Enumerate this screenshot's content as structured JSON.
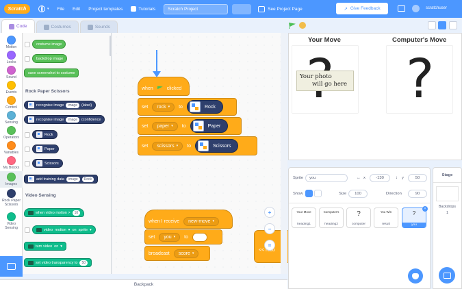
{
  "menu": {
    "logo": "Scratch",
    "file": "File",
    "edit": "Edit",
    "project_templates": "Project templates",
    "tutorials": "Tutorials",
    "project_title": "Scratch Project",
    "see_project_page": "See Project Page",
    "give_feedback": "Give Feedback",
    "account": "scratchuser"
  },
  "tabs": {
    "code": "Code",
    "costumes": "Costumes",
    "sounds": "Sounds"
  },
  "categories": [
    {
      "label": "Motion",
      "color": "#4c97ff"
    },
    {
      "label": "Looks",
      "color": "#9966ff"
    },
    {
      "label": "Sound",
      "color": "#cf63cf"
    },
    {
      "label": "Events",
      "color": "#ffbf00"
    },
    {
      "label": "Control",
      "color": "#ffab19"
    },
    {
      "label": "Sensing",
      "color": "#5cb1d6"
    },
    {
      "label": "Operators",
      "color": "#59c059"
    },
    {
      "label": "Variables",
      "color": "#ff8c1a"
    },
    {
      "label": "My Blocks",
      "color": "#ff6680"
    },
    {
      "label": "Images",
      "color": "#59c059"
    },
    {
      "label": "Rock Paper Scissors",
      "color": "#2e3f6c"
    },
    {
      "label": "Video Sensing",
      "color": "#0fbd8c"
    }
  ],
  "palette": {
    "costume_image": "costume image",
    "backdrop_image": "backdrop image",
    "save_screenshot": "save screenshot to costume",
    "rps_section": "Rock Paper Scissors",
    "recognise_label": "recognise image",
    "image_slot": "image",
    "label_suffix": "(label)",
    "confidence_suffix": "(confidence",
    "rock": "Rock",
    "paper": "Paper",
    "scissors": "Scissors",
    "add_training": "add training data",
    "add_training_value": "Rock",
    "video_section": "Video Sensing",
    "when_motion": "when video motion >",
    "when_motion_value": "10",
    "video_motion": "video",
    "video_motion_dd": "motion",
    "on": "on",
    "on_sprite": "sprite",
    "turn_video": "turn video",
    "turn_video_value": "on",
    "set_transparency": "set video transparency to",
    "set_transparency_value": "50"
  },
  "script1": {
    "when": "when",
    "clicked": "clicked",
    "set": "set",
    "to": "to",
    "rows": [
      {
        "var": "rock",
        "value": "Rock"
      },
      {
        "var": "paper",
        "value": "Paper"
      },
      {
        "var": "scissors",
        "value": "Scissors"
      }
    ]
  },
  "script2": {
    "when_receive": "when I receive",
    "message": "new-move",
    "set": "set",
    "var": "you",
    "to": "to",
    "broadcast": "broadcast",
    "broadcast_msg": "score"
  },
  "background_hat": "<< reco",
  "zoom": {
    "in": "+",
    "out": "−"
  },
  "backpack": "Backpack",
  "stage": {
    "your_move": "Your Move",
    "computer_move": "Computer's Move",
    "qmark": "?",
    "photo_placeholder_line1": "Your photo",
    "photo_placeholder_line2": "will go here"
  },
  "sprite_info": {
    "sprite_label": "Sprite",
    "sprite_name": "you",
    "x_label": "x",
    "x_value": "-130",
    "y_label": "y",
    "y_value": "50",
    "show_label": "Show",
    "size_label": "Size",
    "size_value": "100",
    "direction_label": "Direction",
    "direction_value": "90"
  },
  "sprites": [
    {
      "name": "heading1",
      "preview": "Your Move"
    },
    {
      "name": "heading2",
      "preview": "Computer's"
    },
    {
      "name": "computer",
      "preview": "?"
    },
    {
      "name": "result",
      "preview": "You Win"
    },
    {
      "name": "you",
      "preview": "?"
    }
  ],
  "stage_pane": {
    "title": "Stage",
    "backdrops_label": "Backdrops",
    "backdrops_count": "1"
  }
}
